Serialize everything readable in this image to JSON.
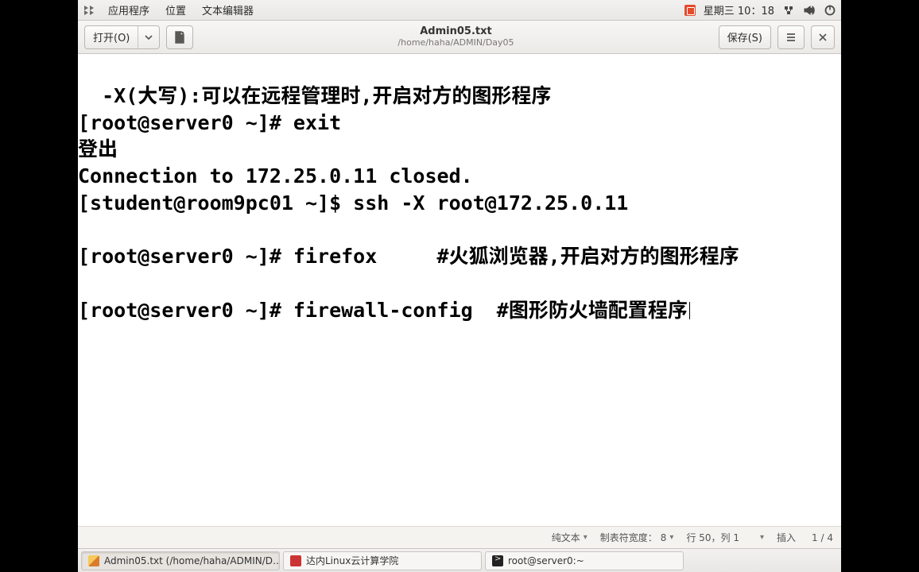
{
  "top_panel": {
    "app_menu": "应用程序",
    "places": "位置",
    "current_app": "文本编辑器",
    "clock": "星期三 10：18"
  },
  "window": {
    "open_label": "打开(O)",
    "save_label": "保存(S)",
    "title": "Admin05.txt",
    "path": "/home/haha/ADMIN/Day05"
  },
  "editor_lines": [
    "  -X(大写):可以在远程管理时,开启对方的图形程序",
    "[root@server0 ~]# exit",
    "登出",
    "Connection to 172.25.0.11 closed.",
    "[student@room9pc01 ~]$ ssh -X root@172.25.0.11",
    "",
    "[root@server0 ~]# firefox     #火狐浏览器,开启对方的图形程序",
    "",
    "[root@server0 ~]# firewall-config  #图形防火墙配置程序"
  ],
  "statusbar": {
    "syntax": "纯文本",
    "tab_width_label": "制表符宽度：",
    "tab_width_value": "8",
    "line_col": "行 50，列 1",
    "ins_mode": "插入",
    "scroll_frac": "1 / 4"
  },
  "taskbar": {
    "item1": "Admin05.txt (/home/haha/ADMIN/D…",
    "item2": "达内Linux云计算学院",
    "item3": "root@server0:~"
  }
}
